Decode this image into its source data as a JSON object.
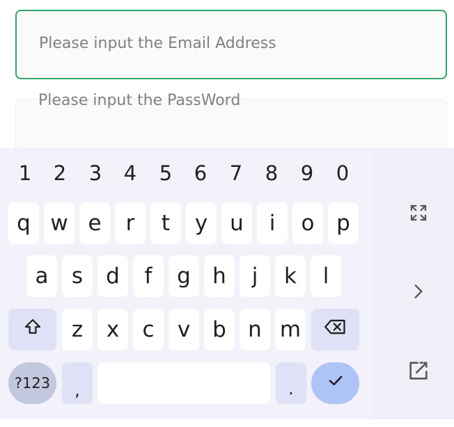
{
  "form": {
    "email": {
      "placeholder": "Please input the Email Address",
      "value": ""
    },
    "password": {
      "placeholder": "Please input the PassWord",
      "value": ""
    }
  },
  "keyboard": {
    "number_row": [
      "1",
      "2",
      "3",
      "4",
      "5",
      "6",
      "7",
      "8",
      "9",
      "0"
    ],
    "row1": [
      "q",
      "w",
      "e",
      "r",
      "t",
      "y",
      "u",
      "i",
      "o",
      "p"
    ],
    "row2": [
      "a",
      "s",
      "d",
      "f",
      "g",
      "h",
      "j",
      "k",
      "l"
    ],
    "row3": [
      "z",
      "x",
      "c",
      "v",
      "b",
      "n",
      "m"
    ],
    "symbols_label": "?123",
    "comma_label": ",",
    "period_label": ".",
    "icons": {
      "shift": "shift-icon",
      "backspace": "backspace-icon",
      "enter": "checkmark-icon",
      "expand": "expand-icon",
      "next": "chevron-right-icon",
      "popout": "popout-icon"
    },
    "colors": {
      "accent_border": "#2ea36a",
      "keyboard_bg": "#f3f1f9",
      "function_key": "#dfe2f6",
      "symbols_key": "#c3c8de",
      "enter_key": "#aec4f7"
    }
  }
}
